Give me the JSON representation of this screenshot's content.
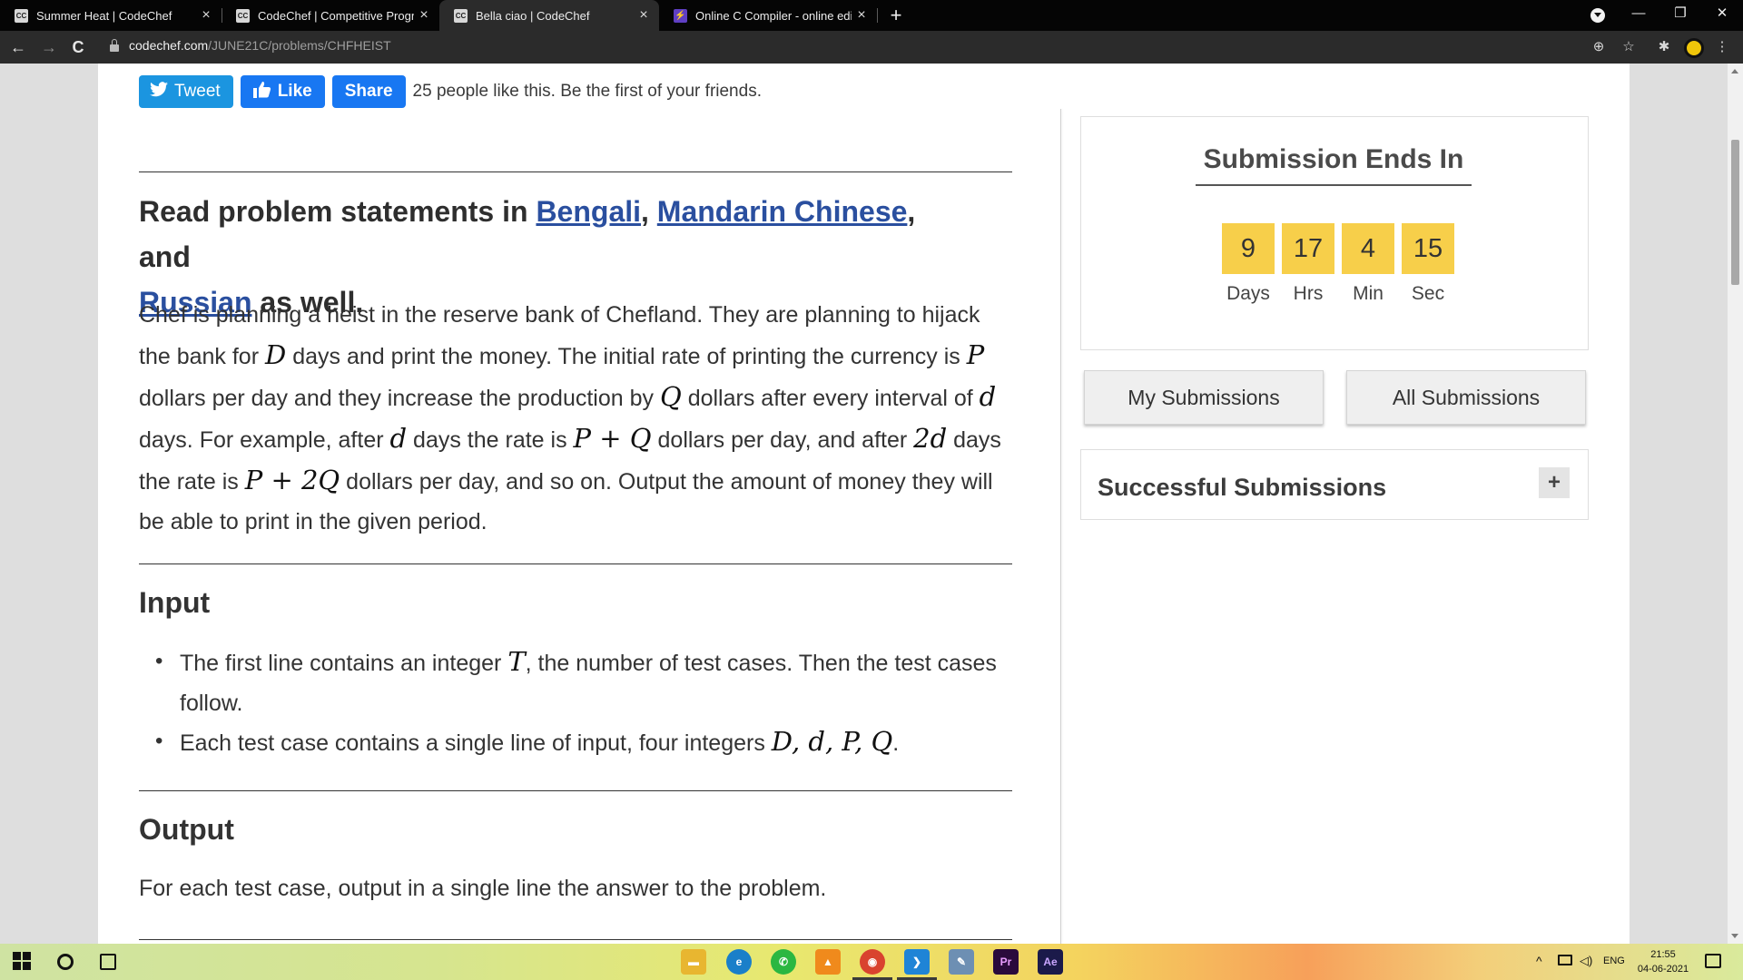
{
  "browser": {
    "tabs": [
      {
        "title": "Summer Heat | CodeChef",
        "favicon": "CC",
        "close": "×"
      },
      {
        "title": "CodeChef | Competitive Programm",
        "favicon": "CC",
        "close": "×"
      },
      {
        "title": "Bella ciao | CodeChef",
        "favicon": "CC",
        "close": "×"
      },
      {
        "title": "Online C Compiler - online editor",
        "favicon": "⚡",
        "close": "×"
      }
    ],
    "active_tab_index": 2,
    "new_tab": "+",
    "window_controls": {
      "minimize": "—",
      "restore": "❐",
      "close": "✕"
    },
    "nav": {
      "back": "←",
      "forward": "→",
      "reload": "C"
    },
    "url_host": "codechef.com",
    "url_path": "/JUNE21C/problems/CHFHEIST",
    "toolbar_icons": {
      "zoom": "⊕",
      "star": "☆",
      "extensions": "✱",
      "menu": "⋮"
    }
  },
  "social": {
    "tweet": "Tweet",
    "like": "Like",
    "share": "Share",
    "like_text": "25 people like this. Be the first of your friends."
  },
  "problem": {
    "read_prefix": "Read problem statements in ",
    "lang1": "Bengali",
    "sep1": ", ",
    "lang2": "Mandarin Chinese",
    "sep2": ", and",
    "lang3": "Russian",
    "read_suffix": " as well.",
    "statement": {
      "s1": "Chef is planning a heist in the reserve bank of Chefland. They are planning to hijack the bank for ",
      "D": "D",
      "s2": " days and print the money. The initial rate of printing the currency is ",
      "P": "P",
      "s3": " dollars per day and they increase the production by ",
      "Q": "Q",
      "s4": " dollars after every interval of ",
      "d": "d",
      "s5": " days. For example, after ",
      "d2": "d",
      "s6": " days the rate is ",
      "PQ": "P + Q",
      "s7": " dollars per day, and after ",
      "two_d": "2d",
      "s8": " days the rate is ",
      "P2Q": "P + 2Q",
      "s9": " dollars per day, and so on. Output the amount of money they will be able to print in the given period."
    },
    "input_heading": "Input",
    "input_items": [
      {
        "pre": "The first line contains an integer ",
        "math": "T",
        "post": ", the number of test cases. Then the test cases follow."
      },
      {
        "pre": "Each test case contains a single line of input, four integers ",
        "math": "D, d, P, Q",
        "post": "."
      }
    ],
    "output_heading": "Output",
    "output_text": "For each test case, output in a single line the answer to the problem."
  },
  "timer": {
    "title": "Submission Ends In",
    "units": [
      {
        "value": "9",
        "label": "Days"
      },
      {
        "value": "17",
        "label": "Hrs"
      },
      {
        "value": "4",
        "label": "Min"
      },
      {
        "value": "15",
        "label": "Sec"
      }
    ]
  },
  "submissions": {
    "my": "My Submissions",
    "all": "All Submissions",
    "successful": "Successful Submissions",
    "expand": "+"
  },
  "taskbar": {
    "apps": [
      {
        "name": "file-explorer",
        "label": "▬",
        "color": "#e8b630"
      },
      {
        "name": "edge",
        "label": "e",
        "color": "#1a7fc9"
      },
      {
        "name": "whatsapp",
        "label": "✆",
        "color": "#2bb741"
      },
      {
        "name": "vlc",
        "label": "▲",
        "color": "#f08a1c"
      },
      {
        "name": "chrome",
        "label": "◉",
        "color": "#d9432f"
      },
      {
        "name": "vscode",
        "label": "❯",
        "color": "#1f84d6"
      },
      {
        "name": "notes",
        "label": "✎",
        "color": "#6d8fb3"
      },
      {
        "name": "premiere",
        "label": "Pr",
        "color": "#2a0a3c"
      },
      {
        "name": "after-effects",
        "label": "Ae",
        "color": "#1b1a4a"
      }
    ],
    "tray_chevron": "^",
    "language": "ENG",
    "time": "21:55",
    "date": "04-06-2021"
  }
}
